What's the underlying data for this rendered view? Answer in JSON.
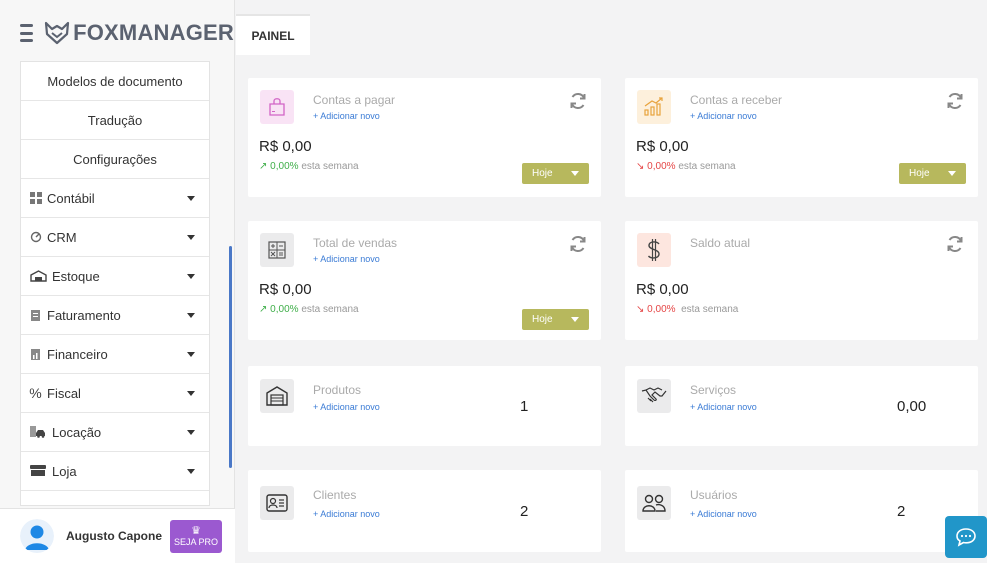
{
  "brand": {
    "name": "FOXMANAGER"
  },
  "sidebar": {
    "sub_items": [
      {
        "label": "Modelos de documento"
      },
      {
        "label": "Tradução"
      },
      {
        "label": "Configurações"
      }
    ],
    "items": [
      {
        "label": "Contábil",
        "icon": "grid-icon"
      },
      {
        "label": "CRM",
        "icon": "crm-icon"
      },
      {
        "label": "Estoque",
        "icon": "warehouse-icon"
      },
      {
        "label": "Faturamento",
        "icon": "invoice-icon"
      },
      {
        "label": "Financeiro",
        "icon": "finance-icon"
      },
      {
        "label": "Fiscal",
        "icon": "percent-icon"
      },
      {
        "label": "Locação",
        "icon": "car-icon"
      },
      {
        "label": "Loja",
        "icon": "store-icon"
      }
    ]
  },
  "user": {
    "name": "Augusto Capone",
    "pro_label": "SEJA PRO"
  },
  "tabs": [
    {
      "label": "PAINEL"
    }
  ],
  "cards": {
    "contas_pagar": {
      "title": "Contas a pagar",
      "add": "+ Adicionar novo",
      "amount": "R$ 0,00",
      "pct": "0,00%",
      "week": "esta semana",
      "period": "Hoje"
    },
    "contas_receber": {
      "title": "Contas a receber",
      "add": "+ Adicionar novo",
      "amount": "R$ 0,00",
      "pct": "0,00%",
      "week": "esta semana",
      "period": "Hoje"
    },
    "total_vendas": {
      "title": "Total de vendas",
      "add": "+ Adicionar novo",
      "amount": "R$ 0,00",
      "pct": "0,00%",
      "week": "esta semana",
      "period": "Hoje"
    },
    "saldo_atual": {
      "title": "Saldo atual",
      "amount": "R$ 0,00",
      "pct": "0,00%",
      "week": "esta semana"
    },
    "produtos": {
      "title": "Produtos",
      "add": "+ Adicionar novo",
      "count": "1"
    },
    "servicos": {
      "title": "Serviços",
      "add": "+ Adicionar novo",
      "count": "0,00"
    },
    "clientes": {
      "title": "Clientes",
      "add": "+ Adicionar novo",
      "count": "2"
    },
    "usuarios": {
      "title": "Usuários",
      "add": "+ Adicionar novo",
      "count": "2"
    }
  },
  "colors": {
    "accent": "#3a7bd5",
    "period_button": "#b7b85d",
    "trend_up": "#3fae49",
    "trend_down": "#e54545",
    "pro_button": "#9b59d0",
    "chat_button": "#2196c9"
  }
}
